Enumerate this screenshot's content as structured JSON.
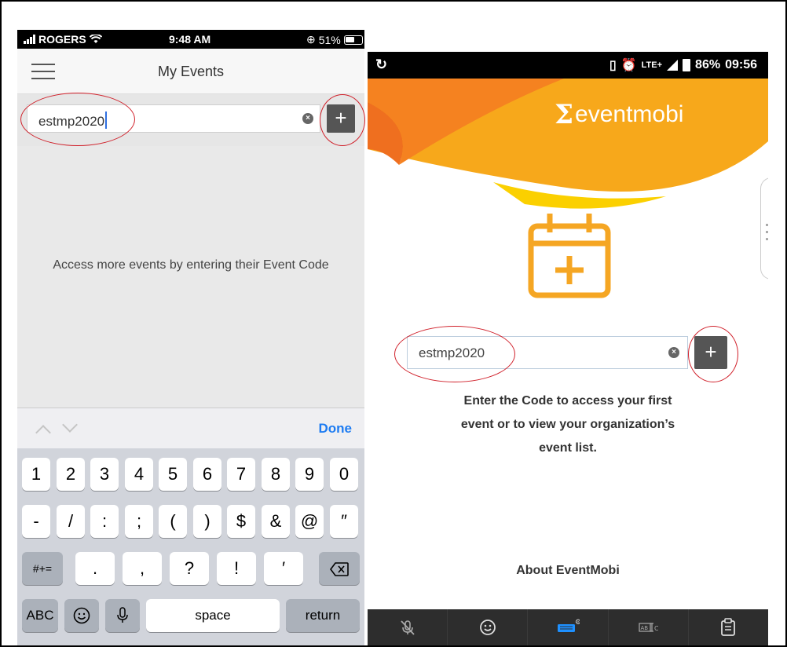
{
  "ios": {
    "status": {
      "carrier": "ROGERS",
      "time": "9:48 AM",
      "battery": "51%"
    },
    "header": {
      "title": "My Events"
    },
    "search": {
      "value": "estmp2020"
    },
    "plus_label": "+",
    "clear_label": "×",
    "hint": "Access more events by entering their Event Code",
    "accessory": {
      "done_label": "Done"
    },
    "keyboard": {
      "row1": [
        "1",
        "2",
        "3",
        "4",
        "5",
        "6",
        "7",
        "8",
        "9",
        "0"
      ],
      "row2": [
        "-",
        "/",
        ":",
        ";",
        "(",
        ")",
        "$",
        "&",
        "@",
        "″"
      ],
      "row3": {
        "mode": "#+=",
        "keys": [
          ".",
          ",",
          "?",
          "!",
          "′"
        ]
      },
      "row4": {
        "abc": "ABC",
        "space": "space",
        "return": "return"
      }
    }
  },
  "android": {
    "status": {
      "battery": "86%",
      "time": "09:56",
      "network": "LTE+"
    },
    "brand": {
      "name": "eventmobi",
      "mark": "Σ"
    },
    "search": {
      "value": "estmp2020"
    },
    "plus_label": "+",
    "clear_label": "×",
    "info": {
      "line1": "Enter the Code to access your first",
      "line2": "event or to view your organization’s",
      "line3": "event list."
    },
    "about_label": "About EventMobi"
  },
  "colors": {
    "accent_orange": "#f5a623",
    "annotation_red": "#d0202a",
    "ios_blue": "#1e7cf2",
    "button_dark": "#555555"
  }
}
